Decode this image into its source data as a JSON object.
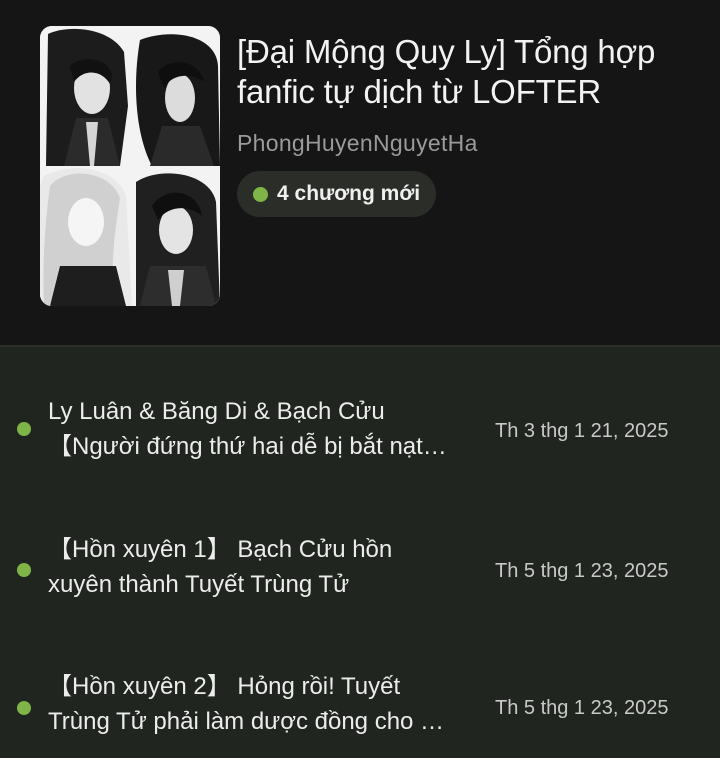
{
  "story": {
    "title": "[Đại Mộng Quy Ly] Tổng hợp fanfic tự dịch từ LOFTER",
    "author": "PhongHuyenNguyetHa",
    "badge": "4 chương mới"
  },
  "chapters": [
    {
      "line1": "Ly Luân & Băng Di & Bạch Cửu",
      "line2": "【Người đứng thứ hai dễ bị bắt nạt…",
      "date": "Th 3 thg 1 21, 2025"
    },
    {
      "line1": "【Hồn xuyên 1】 Bạch Cửu hồn",
      "line2": "xuyên thành Tuyết Trùng Tử",
      "date": "Th 5 thg 1 23, 2025"
    },
    {
      "line1": "【Hồn xuyên 2】 Hỏng rồi! Tuyết",
      "line2": "Trùng Tử phải làm dược đồng cho …",
      "date": "Th 5 thg 1 23, 2025"
    }
  ],
  "colors": {
    "accent": "#7fb548",
    "background": "#121212",
    "list_background": "#212520"
  }
}
